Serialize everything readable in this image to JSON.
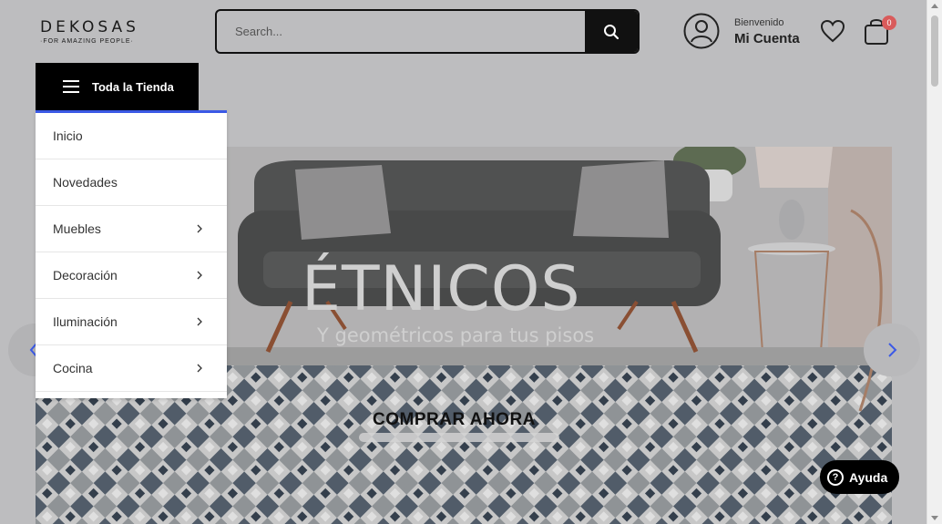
{
  "header": {
    "logo_brand": "DEKOSAS",
    "logo_tagline": "·FOR AMAZING PEOPLE·",
    "search_placeholder": "Search...",
    "search_icon": "search-icon",
    "account_greeting": "Bienvenido",
    "account_label": "Mi Cuenta",
    "cart_count": "0"
  },
  "category_menu": {
    "button_label": "Toda la Tienda",
    "accent_color": "#3b59e6",
    "items": [
      {
        "label": "Inicio",
        "has_submenu": false
      },
      {
        "label": "Novedades",
        "has_submenu": false
      },
      {
        "label": "Muebles",
        "has_submenu": true
      },
      {
        "label": "Decoración",
        "has_submenu": true
      },
      {
        "label": "Iluminación",
        "has_submenu": true
      },
      {
        "label": "Cocina",
        "has_submenu": true
      }
    ]
  },
  "banner": {
    "title": "ÉTNICOS",
    "subtitle": "Y geométricos para tus pisos",
    "cta": "COMPRAR AHORA"
  },
  "help_widget": {
    "label": "Ayuda"
  }
}
